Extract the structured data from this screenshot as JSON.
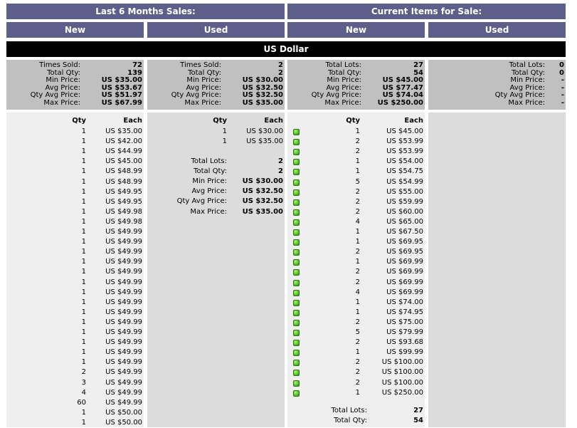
{
  "headers": {
    "last6": "Last 6 Months Sales:",
    "current": "Current Items for Sale:",
    "new": "New",
    "used": "Used"
  },
  "currency_bar": "US Dollar",
  "summary_labels": {
    "times_sold": "Times Sold:",
    "total_lots": "Total Lots:",
    "total_qty": "Total Qty:",
    "min_price": "Min Price:",
    "avg_price": "Avg Price:",
    "qty_avg_price": "Qty Avg Price:",
    "max_price": "Max Price:"
  },
  "summaries": {
    "sold_new": [
      "72",
      "139",
      "US $35.00",
      "US $53.67",
      "US $51.97",
      "US $67.99"
    ],
    "sold_used": [
      "2",
      "2",
      "US $30.00",
      "US $32.50",
      "US $32.50",
      "US $35.00"
    ],
    "cur_new": [
      "27",
      "54",
      "US $45.00",
      "US $77.47",
      "US $74.04",
      "US $250.00"
    ],
    "cur_used": [
      "0",
      "0",
      "-",
      "-",
      "-",
      "-"
    ]
  },
  "col_headers": {
    "qty": "Qty",
    "each": "Each"
  },
  "sold_new_rows": [
    [
      "1",
      "US $35.00"
    ],
    [
      "1",
      "US $42.00"
    ],
    [
      "1",
      "US $44.99"
    ],
    [
      "1",
      "US $45.00"
    ],
    [
      "1",
      "US $48.99"
    ],
    [
      "1",
      "US $48.99"
    ],
    [
      "1",
      "US $49.95"
    ],
    [
      "1",
      "US $49.95"
    ],
    [
      "1",
      "US $49.98"
    ],
    [
      "1",
      "US $49.98"
    ],
    [
      "1",
      "US $49.99"
    ],
    [
      "1",
      "US $49.99"
    ],
    [
      "1",
      "US $49.99"
    ],
    [
      "1",
      "US $49.99"
    ],
    [
      "1",
      "US $49.99"
    ],
    [
      "1",
      "US $49.99"
    ],
    [
      "1",
      "US $49.99"
    ],
    [
      "1",
      "US $49.99"
    ],
    [
      "1",
      "US $49.99"
    ],
    [
      "1",
      "US $49.99"
    ],
    [
      "1",
      "US $49.99"
    ],
    [
      "1",
      "US $49.99"
    ],
    [
      "1",
      "US $49.99"
    ],
    [
      "1",
      "US $49.99"
    ],
    [
      "2",
      "US $49.99"
    ],
    [
      "3",
      "US $49.99"
    ],
    [
      "4",
      "US $49.99"
    ],
    [
      "60",
      "US $49.99"
    ],
    [
      "1",
      "US $50.00"
    ],
    [
      "1",
      "US $50.00"
    ]
  ],
  "sold_used_rows": [
    [
      "1",
      "US $30.00"
    ],
    [
      "1",
      "US $35.00"
    ]
  ],
  "sold_used_totals": {
    "labels": [
      "Total Lots:",
      "Total Qty:",
      "Min Price:",
      "Avg Price:",
      "Qty Avg Price:",
      "Max Price:"
    ],
    "values": [
      "2",
      "2",
      "US $30.00",
      "US $32.50",
      "US $32.50",
      "US $35.00"
    ]
  },
  "cur_new_rows": [
    [
      "1",
      "US $45.00"
    ],
    [
      "2",
      "US $53.99"
    ],
    [
      "2",
      "US $53.99"
    ],
    [
      "1",
      "US $54.00"
    ],
    [
      "1",
      "US $54.75"
    ],
    [
      "5",
      "US $54.99"
    ],
    [
      "2",
      "US $55.00"
    ],
    [
      "2",
      "US $59.99"
    ],
    [
      "2",
      "US $60.00"
    ],
    [
      "4",
      "US $65.00"
    ],
    [
      "1",
      "US $67.50"
    ],
    [
      "1",
      "US $69.95"
    ],
    [
      "2",
      "US $69.95"
    ],
    [
      "1",
      "US $69.99"
    ],
    [
      "2",
      "US $69.99"
    ],
    [
      "2",
      "US $69.99"
    ],
    [
      "4",
      "US $69.99"
    ],
    [
      "1",
      "US $74.00"
    ],
    [
      "1",
      "US $74.95"
    ],
    [
      "2",
      "US $75.00"
    ],
    [
      "5",
      "US $79.99"
    ],
    [
      "2",
      "US $93.68"
    ],
    [
      "1",
      "US $99.99"
    ],
    [
      "2",
      "US $100.00"
    ],
    [
      "2",
      "US $100.00"
    ],
    [
      "2",
      "US $100.00"
    ],
    [
      "1",
      "US $250.00"
    ]
  ],
  "cur_new_totals": {
    "labels": [
      "Total Lots:",
      "Total Qty:"
    ],
    "values": [
      "27",
      "54"
    ]
  },
  "row_icon": "green-box-icon"
}
